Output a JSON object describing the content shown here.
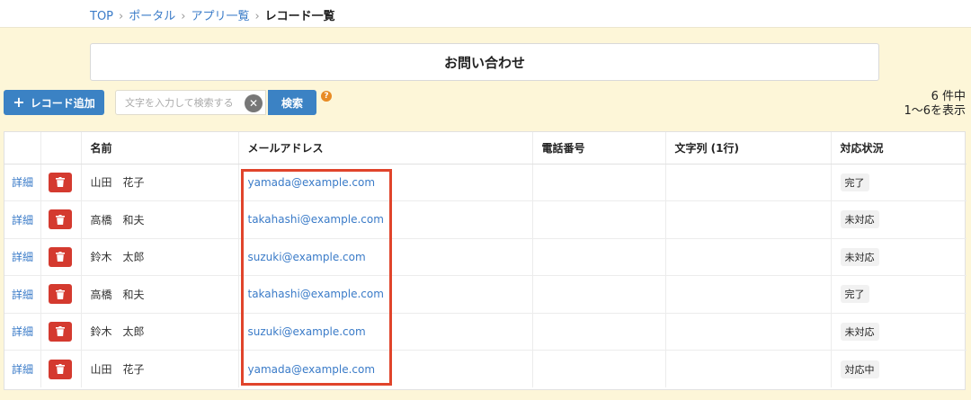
{
  "breadcrumb": {
    "items": [
      "TOP",
      "ポータル",
      "アプリ一覧"
    ],
    "current": "レコード一覧",
    "separator": "›"
  },
  "app": {
    "title": "お問い合わせ"
  },
  "toolbar": {
    "add_label": "レコード追加",
    "search_placeholder": "文字を入力して検索する",
    "search_value": "",
    "search_label": "検索",
    "help_glyph": "?"
  },
  "summary": {
    "total": "6 件中",
    "range": "1～6を表示"
  },
  "table": {
    "headers": [
      "",
      "",
      "名前",
      "メールアドレス",
      "電話番号",
      "文字列 (1行)",
      "対応状況"
    ],
    "detail_label": "詳細",
    "rows": [
      {
        "name": "山田　花子",
        "email": "yamada@example.com",
        "phone": "",
        "text": "",
        "status": "完了"
      },
      {
        "name": "高橋　和夫",
        "email": "takahashi@example.com",
        "phone": "",
        "text": "",
        "status": "未対応"
      },
      {
        "name": "鈴木　太郎",
        "email": "suzuki@example.com",
        "phone": "",
        "text": "",
        "status": "未対応"
      },
      {
        "name": "高橋　和夫",
        "email": "takahashi@example.com",
        "phone": "",
        "text": "",
        "status": "完了"
      },
      {
        "name": "鈴木　太郎",
        "email": "suzuki@example.com",
        "phone": "",
        "text": "",
        "status": "未対応"
      },
      {
        "name": "山田　花子",
        "email": "yamada@example.com",
        "phone": "",
        "text": "",
        "status": "対応中"
      }
    ]
  },
  "colors": {
    "background": "#fdf6d8",
    "primary": "#3b82c4",
    "link": "#3a7bc8",
    "delete": "#d43a2f",
    "highlight": "#e0442b",
    "help": "#e88b24"
  },
  "icons": {
    "add": "plus-icon",
    "clear": "clear-icon",
    "help": "question-icon",
    "delete": "trash-icon"
  }
}
